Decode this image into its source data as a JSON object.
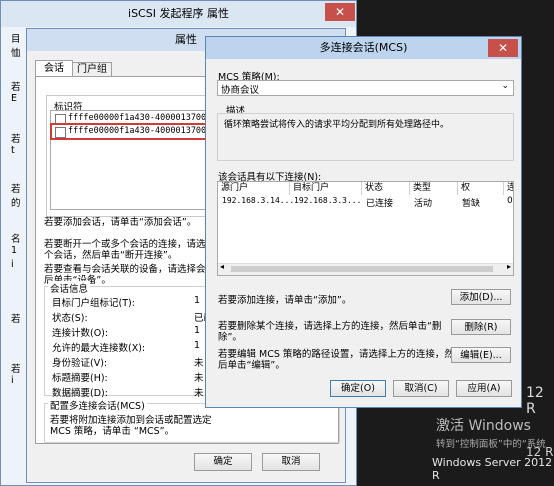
{
  "desktop": {
    "activate_title": "激活 Windows",
    "activate_hint": "转到“控制面板”中的“系统",
    "os_name": "Windows Server 2012 R",
    "side_text_1": "12 R",
    "side_text_2": "12 R"
  },
  "iscsi_window": {
    "title": "iSCSI 发起程序 属性",
    "close": "✕",
    "left_chars": [
      "目",
      "恤",
      "若",
      "E",
      "若",
      "t",
      "若",
      "的",
      "名",
      "1",
      "i",
      "若",
      "若",
      "i"
    ]
  },
  "props_dialog": {
    "title": "属性",
    "tabs": [
      "会话",
      "门户组"
    ],
    "identifier_label": "标识符",
    "sessions": [
      {
        "id": "ffffe00000f1a430-4000013700000007",
        "checked": false
      },
      {
        "id": "ffffe00000f1a430-4000013700000008",
        "checked": false
      }
    ],
    "add_session_text": "若要添加会话，请单击“添加会话”。",
    "disconnect_text_1": "若要断开一个或多个会话的连接，请选择",
    "disconnect_text_2": "个会话，然后单击“断开连接”。",
    "devices_text_1": "若要查看与会话关联的设备，请选择会话",
    "devices_text_2": "后单击“设备”。",
    "session_info_title": "会话信息",
    "session_info": [
      {
        "label": "目标门户组标记(T):",
        "value": "1"
      },
      {
        "label": "状态(S):",
        "value": "已i"
      },
      {
        "label": "连接计数(O):",
        "value": "1"
      },
      {
        "label": "允许的最大连接数(X):",
        "value": "1"
      },
      {
        "label": "身份验证(V):",
        "value": "未"
      },
      {
        "label": "标题摘要(H):",
        "value": "未"
      },
      {
        "label": "数据摘要(D):",
        "value": "未"
      }
    ],
    "mcs_group_title": "配置多连接会话(MCS)",
    "mcs_text_1": "若要将附加连接添加到会话或配置选定",
    "mcs_text_2": "MCS 策略，请单击 “MCS”。",
    "ok": "确定",
    "cancel": "取消"
  },
  "mcs_dialog": {
    "title": "多连接会话(MCS)",
    "close": "✕",
    "policy_label": "MCS 策略(M):",
    "policy_value": "协商会议",
    "description_label": "描述",
    "description_text": "循环策略尝试将传入的请求平均分配到所有处理路径中。",
    "connections_label": "该会话具有以下连接(N):",
    "columns": [
      "源门户",
      "目标门户",
      "状态",
      "类型",
      "权",
      "连"
    ],
    "rows": [
      {
        "source": "192.168.3.14...",
        "target": "192.168.3.3...",
        "status": "已连接",
        "type": "活动",
        "weight": "暂缺",
        "conn": "0"
      }
    ],
    "add_text": "若要添加连接，请单击“添加”。",
    "add_button": "添加(D)...",
    "remove_text_1": "若要删除某个连接，请选择上方的连接，然后单击“删",
    "remove_text_2": "除”。",
    "remove_button": "删除(R)",
    "edit_text_1": "若要编辑 MCS 策略的路径设置，请选择上方的连接，然",
    "edit_text_2": "后单击“编辑”。",
    "edit_button": "编辑(E)...",
    "ok": "确定(O)",
    "cancel": "取消(C)",
    "apply": "应用(A)"
  }
}
